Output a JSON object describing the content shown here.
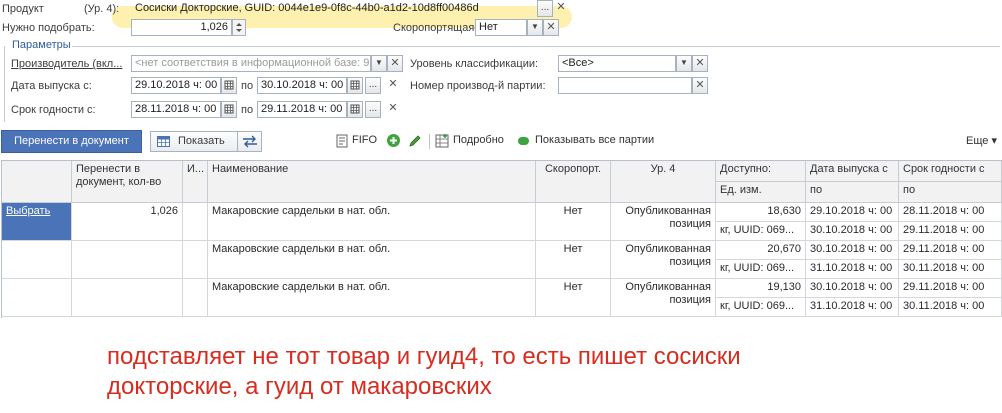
{
  "product": {
    "label": "Продукт",
    "level": "(Ур. 4):",
    "value": "Сосиски Докторские, GUID: 0044e1e9-0f8c-44b0-a1d2-10d8ff00486d",
    "choose_btn": "...",
    "clear_btn": "✕"
  },
  "need": {
    "label": "Нужно подобрать:",
    "value": "1,026"
  },
  "perishable": {
    "label": "Скоропортящаяся:",
    "value": "Нет"
  },
  "params": {
    "title": "Параметры",
    "manufacturer_label": "Производитель (вкл...",
    "manufacturer_placeholder": "<нет соответствия в информационной базе: 9",
    "release_label": "Дата выпуска с:",
    "release_from": "29.10.2018  ч: 00",
    "release_to": "30.10.2018  ч: 00",
    "po": "по",
    "shelf_label": "Срок годности с:",
    "shelf_from": "28.11.2018  ч: 00",
    "shelf_to": "29.11.2018  ч: 00",
    "class_label": "Уровень классификации:",
    "class_value": "<Все>",
    "batch_label": "Номер производ-й партии:",
    "batch_value": ""
  },
  "toolbar": {
    "transfer_btn": "Перенести в документ",
    "show_btn": "Показать",
    "fifo": "FIFO",
    "details": "Подробно",
    "show_all": "Показывать все партии",
    "more": "Еще ▾"
  },
  "table": {
    "headers": {
      "transfer": "Перенести в документ, кол-во",
      "i": "И...",
      "name": "Наименование",
      "perishable": "Скоропорт.",
      "level": "Ур. 4",
      "available": "Доступно:",
      "unit": "Ед. изм.",
      "release": "Дата выпуска с",
      "release_to": "по",
      "shelf": "Срок годности с",
      "shelf_to": "по"
    },
    "rows": [
      {
        "action": "Выбрать",
        "qty": "1,026",
        "name": "Макаровские сардельки в нат. обл.",
        "perishable": "Нет",
        "level1": "Опубликованная",
        "level2": "позиция",
        "available": "18,630",
        "unit": "кг, UUID: 069...",
        "release_from": "29.10.2018  ч: 00",
        "release_to": "30.10.2018  ч: 00",
        "shelf_from": "28.11.2018  ч: 00",
        "shelf_to": "29.11.2018  ч: 00"
      },
      {
        "action": "",
        "qty": "",
        "name": "Макаровские сардельки в нат. обл.",
        "perishable": "Нет",
        "level1": "Опубликованная",
        "level2": "позиция",
        "available": "20,670",
        "unit": "кг, UUID: 069...",
        "release_from": "30.10.2018  ч: 00",
        "release_to": "31.10.2018  ч: 00",
        "shelf_from": "29.11.2018  ч: 00",
        "shelf_to": "30.11.2018  ч: 00"
      },
      {
        "action": "",
        "qty": "",
        "name": "Макаровские сардельки в нат. обл.",
        "perishable": "Нет",
        "level1": "Опубликованная",
        "level2": "позиция",
        "available": "19,130",
        "unit": "кг, UUID: 069...",
        "release_from": "30.10.2018  ч: 00",
        "release_to": "31.10.2018  ч: 00",
        "shelf_from": "29.11.2018  ч: 00",
        "shelf_to": "30.11.2018  ч: 00"
      }
    ]
  },
  "annotation": {
    "line1": "подставляет не тот товар и гуид4, то есть пишет сосиски",
    "line2": "докторские, а гуид от макаровских"
  },
  "colors": {
    "accent": "#4a73b8",
    "annotation": "#d62d20",
    "highlight": "#fde66e"
  }
}
